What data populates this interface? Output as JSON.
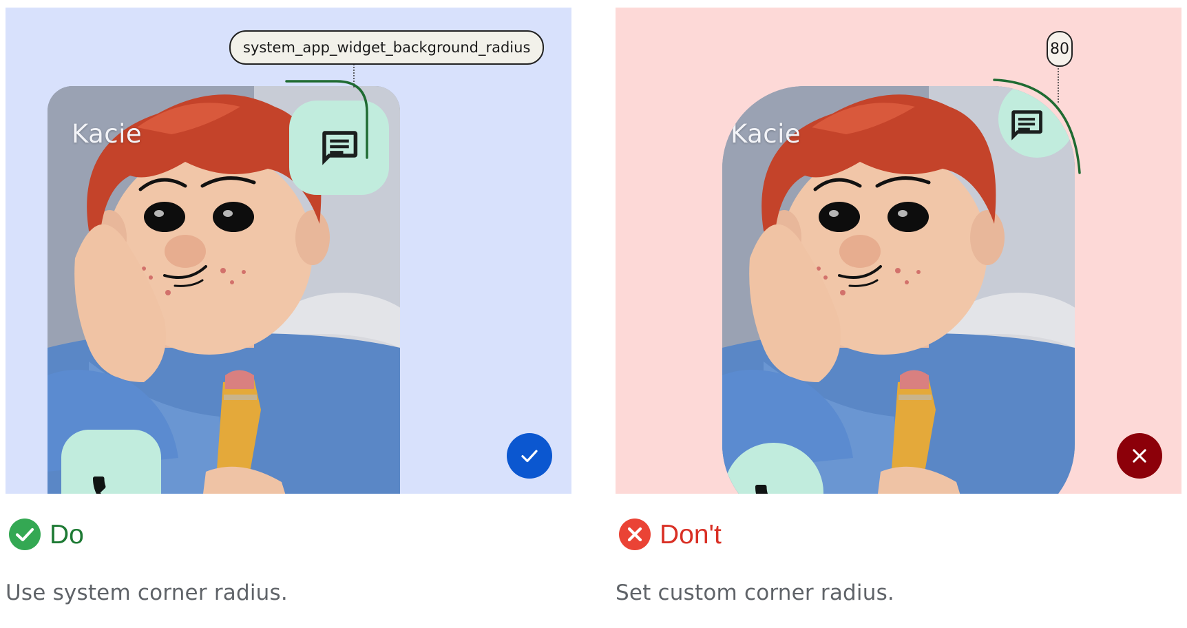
{
  "do_example": {
    "contact_name": "Kacie",
    "radius_label": "system_app_widget_background_radius",
    "verdict": "Do",
    "caption": "Use system corner radius.",
    "status_icon": "check-icon",
    "verdict_icon": "check-circle-icon",
    "panel_color": "#d8e1fc",
    "accent_color": "#1e7a34"
  },
  "dont_example": {
    "contact_name": "Kacie",
    "radius_label": "80",
    "verdict": "Don't",
    "caption": "Set custom corner radius.",
    "status_icon": "close-icon",
    "verdict_icon": "error-circle-icon",
    "panel_color": "#fdd9d7",
    "accent_color": "#d93025"
  },
  "widget": {
    "message_icon": "message-icon",
    "call_icon": "phone-icon",
    "fab_color": "#c1ecdd"
  }
}
